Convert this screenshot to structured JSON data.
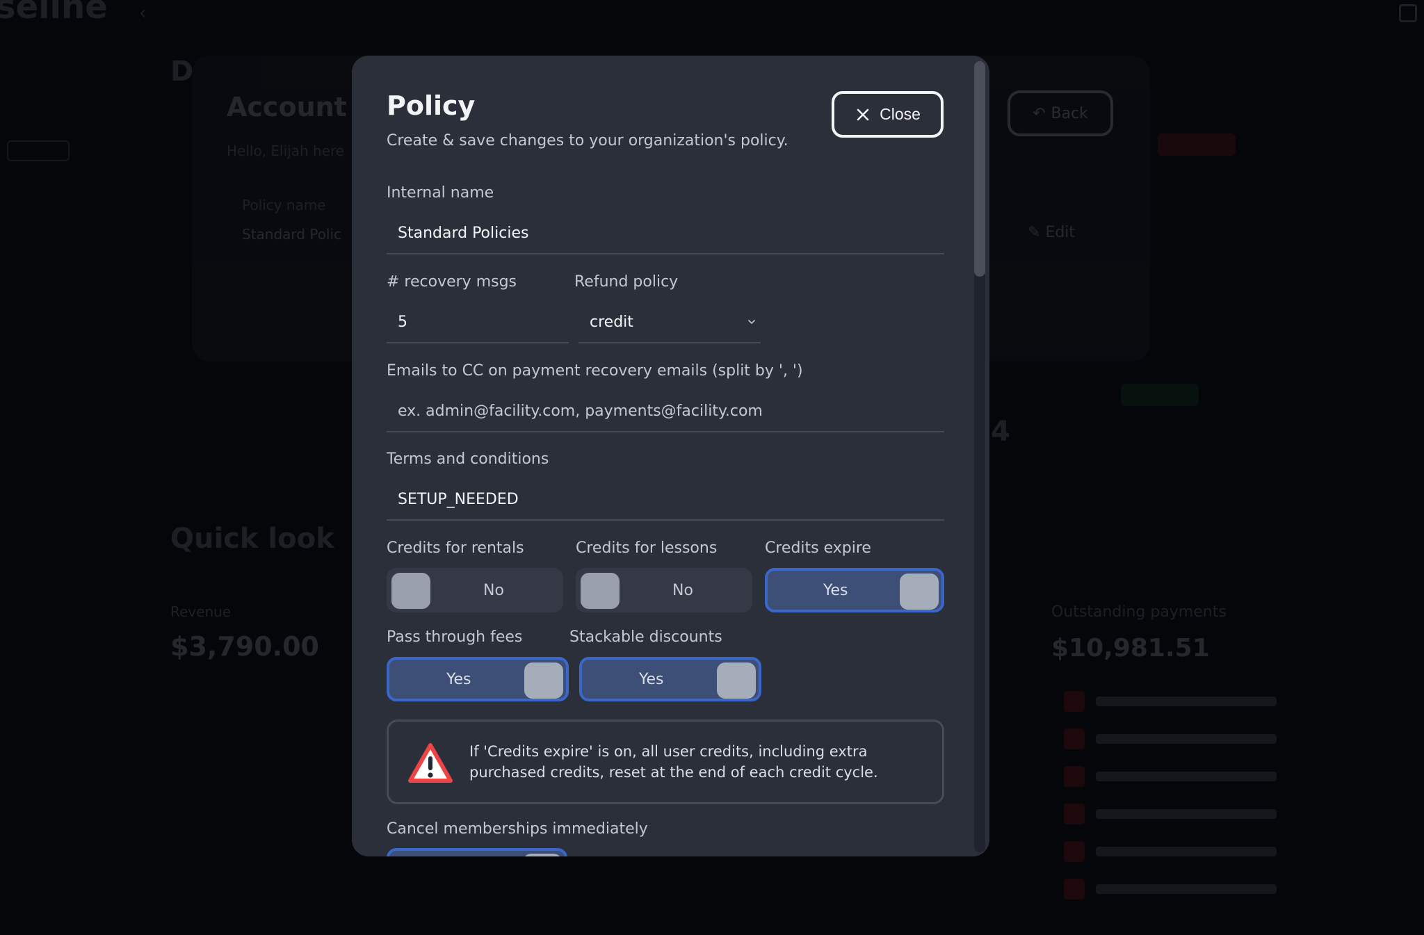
{
  "background": {
    "app_logo": "seline",
    "dashboard_heading": "D",
    "account_title": "Account S",
    "account_subtitle": "Hello, Elijah here",
    "policy_name_label": "Policy name",
    "policy_name_value": "Standard Polic",
    "back_label": "Back",
    "edit_label": "Edit",
    "quick_look": "Quick look",
    "revenue_label": "Revenue",
    "revenue_value": "$3,790.00",
    "outstanding_label": "Outstanding payments",
    "outstanding_value": "$10,981.51",
    "big_number": "4"
  },
  "modal": {
    "title": "Policy",
    "subtitle": "Create & save changes to your organization's policy.",
    "close_label": "Close",
    "fields": {
      "internal_name": {
        "label": "Internal name",
        "value": "Standard Policies"
      },
      "recovery_msgs": {
        "label": "# recovery msgs",
        "value": "5"
      },
      "refund_policy": {
        "label": "Refund policy",
        "value": "credit"
      },
      "cc_emails": {
        "label": "Emails to CC on payment recovery emails (split by ', ')",
        "placeholder": "ex. admin@facility.com, payments@facility.com"
      },
      "terms": {
        "label": "Terms and conditions",
        "value": "SETUP_NEEDED"
      }
    },
    "toggles": {
      "credits_rentals": {
        "label": "Credits for rentals",
        "state": "No"
      },
      "credits_lessons": {
        "label": "Credits for lessons",
        "state": "No"
      },
      "credits_expire": {
        "label": "Credits expire",
        "state": "Yes"
      },
      "pass_through_fees": {
        "label": "Pass through fees",
        "state": "Yes"
      },
      "stackable_discounts": {
        "label": "Stackable discounts",
        "state": "Yes"
      }
    },
    "notice": {
      "icon": "warning-icon",
      "text": "If 'Credits expire' is on, all user credits, including extra purchased credits, reset at the end of each credit cycle."
    },
    "cancel_memberships": {
      "label": "Cancel memberships immediately"
    }
  },
  "colors": {
    "modal_bg": "#2b2f3a",
    "toggle_on_bg": "#3e4f77",
    "toggle_on_border": "#3a67c9",
    "warning_red": "#ef4444"
  }
}
